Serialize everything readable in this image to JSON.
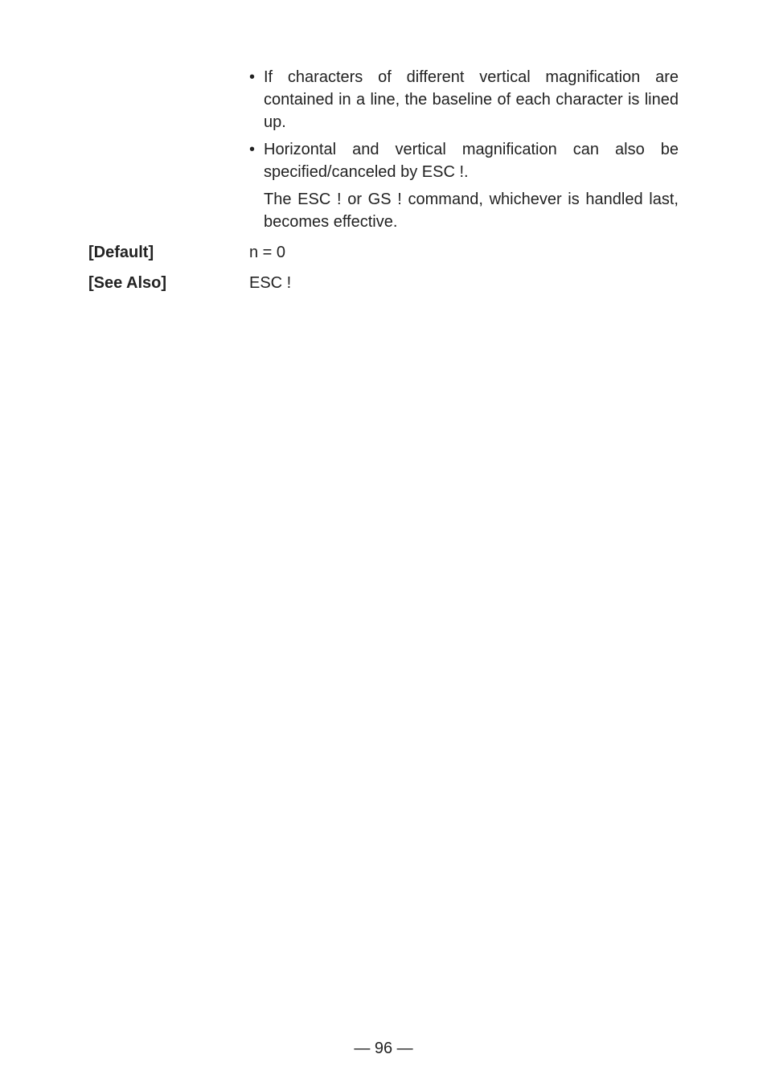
{
  "bullets": [
    {
      "text": "If characters of different vertical magnification are contained in a line, the baseline of each character is lined up."
    },
    {
      "text": "Horizontal and vertical magnification can also be specified/canceled by ESC !.",
      "followup": "The ESC ! or GS ! command, whichever is handled last, becomes effective."
    }
  ],
  "default": {
    "label": "[Default]",
    "value": "n = 0"
  },
  "seeAlso": {
    "label": "[See Also]",
    "value": "ESC !"
  },
  "footer": "— 96 —"
}
